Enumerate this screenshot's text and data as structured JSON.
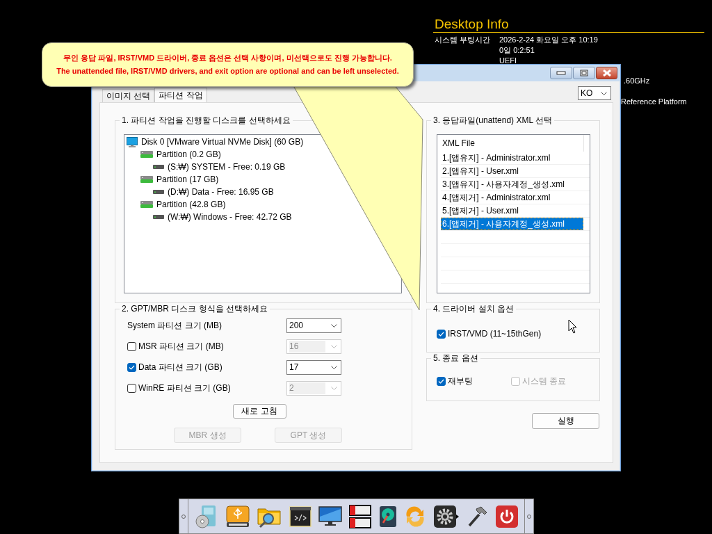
{
  "desktop_info": {
    "title": "Desktop Info",
    "rows": [
      {
        "label": "시스템 부팅시간",
        "value": "2026-2-24 화요일 오후 10:19"
      },
      {
        "value": "0일 0:2:51"
      },
      {
        "value": "UEFI"
      }
    ],
    "fragments": [
      ".60GHz",
      "Reference Platform"
    ]
  },
  "callout": {
    "lines": [
      "무인 응답 파일, IRST/VMD 드라이버, 종료 옵션은 선택 사항이며, 미선택으로도 진행 가능합니다.",
      "The unattended file, IRST/VMD drivers, and exit option are optional and can be left unselected."
    ]
  },
  "window": {
    "tabs": [
      {
        "label": "이미지 선택",
        "selected": false
      },
      {
        "label": "파티션 작업",
        "selected": true
      }
    ],
    "language": {
      "value": "KO"
    },
    "disk_group": {
      "title": "1. 파티션 작업을 진행할 디스크를 선택하세요",
      "tree": [
        {
          "kind": "disk",
          "label": "Disk 0 [VMware Virtual NVMe Disk] (60 GB)",
          "children": [
            {
              "kind": "partition",
              "label": "Partition (0.2 GB)",
              "children": [
                {
                  "kind": "volume",
                  "label": "(S:₩) SYSTEM - Free: 0.19 GB"
                }
              ]
            },
            {
              "kind": "partition",
              "label": "Partition (17 GB)",
              "children": [
                {
                  "kind": "volume",
                  "label": "(D:₩) Data - Free: 16.95 GB"
                }
              ]
            },
            {
              "kind": "partition",
              "label": "Partition (42.8 GB)",
              "children": [
                {
                  "kind": "volume",
                  "label": "(W:₩) Windows - Free: 42.72 GB"
                }
              ]
            }
          ]
        }
      ]
    },
    "format_group": {
      "title": "2. GPT/MBR 디스크 형식을 선택하세요",
      "rows": [
        {
          "kind": "plain",
          "label": "System 파티션 크기 (MB)",
          "value": "200",
          "disabled": false
        },
        {
          "kind": "checkbox",
          "label": "MSR 파티션 크기 (MB)",
          "checked": false,
          "value": "16",
          "disabled": true
        },
        {
          "kind": "checkbox",
          "label": "Data 파티션 크기 (GB)",
          "checked": true,
          "value": "17",
          "disabled": false
        },
        {
          "kind": "checkbox",
          "label": "WinRE 파티션 크기 (GB)",
          "checked": false,
          "value": "2",
          "disabled": true
        }
      ],
      "refresh_button": "새로 고침",
      "buttons": [
        {
          "label": "MBR 생성",
          "disabled": true
        },
        {
          "label": "GPT 생성",
          "disabled": true
        }
      ]
    },
    "xml_group": {
      "title": "3. 응답파일(unattend) XML 선택",
      "column": "XML File",
      "rows": [
        {
          "label": "1.[앱유지] - Administrator.xml",
          "selected": false
        },
        {
          "label": "2.[앱유지] - User.xml",
          "selected": false
        },
        {
          "label": "3.[앱유지] - 사용자계정_생성.xml",
          "selected": false
        },
        {
          "label": "4.[앱제거] - Administrator.xml",
          "selected": false
        },
        {
          "label": "5.[앱제거] - User.xml",
          "selected": false
        },
        {
          "label": "6.[앱제거] - 사용자계정_생성.xml",
          "selected": true
        }
      ]
    },
    "driver_group": {
      "title": "4. 드라이버 설치 옵션",
      "options": [
        {
          "label": "IRST/VMD (11~15thGen)",
          "checked": true,
          "disabled": false
        }
      ]
    },
    "exit_group": {
      "title": "5. 종료 옵션",
      "options": [
        {
          "label": "재부팅",
          "checked": true,
          "disabled": false
        },
        {
          "label": "시스템 종료",
          "checked": false,
          "disabled": true
        }
      ]
    },
    "run_button": "실행"
  },
  "dock": {
    "items": [
      {
        "kind": "disc",
        "submenu": false
      },
      {
        "kind": "usb",
        "submenu": false
      },
      {
        "kind": "folder-search",
        "submenu": false
      },
      {
        "kind": "terminal",
        "submenu": false
      },
      {
        "kind": "monitor",
        "submenu": false
      },
      {
        "kind": "drive-bay",
        "submenu": false
      },
      {
        "kind": "hard-disk",
        "submenu": false
      },
      {
        "kind": "sync",
        "submenu": false
      },
      {
        "kind": "gear",
        "submenu": true
      },
      {
        "kind": "hammer",
        "submenu": false
      },
      {
        "kind": "power",
        "submenu": false
      }
    ]
  }
}
